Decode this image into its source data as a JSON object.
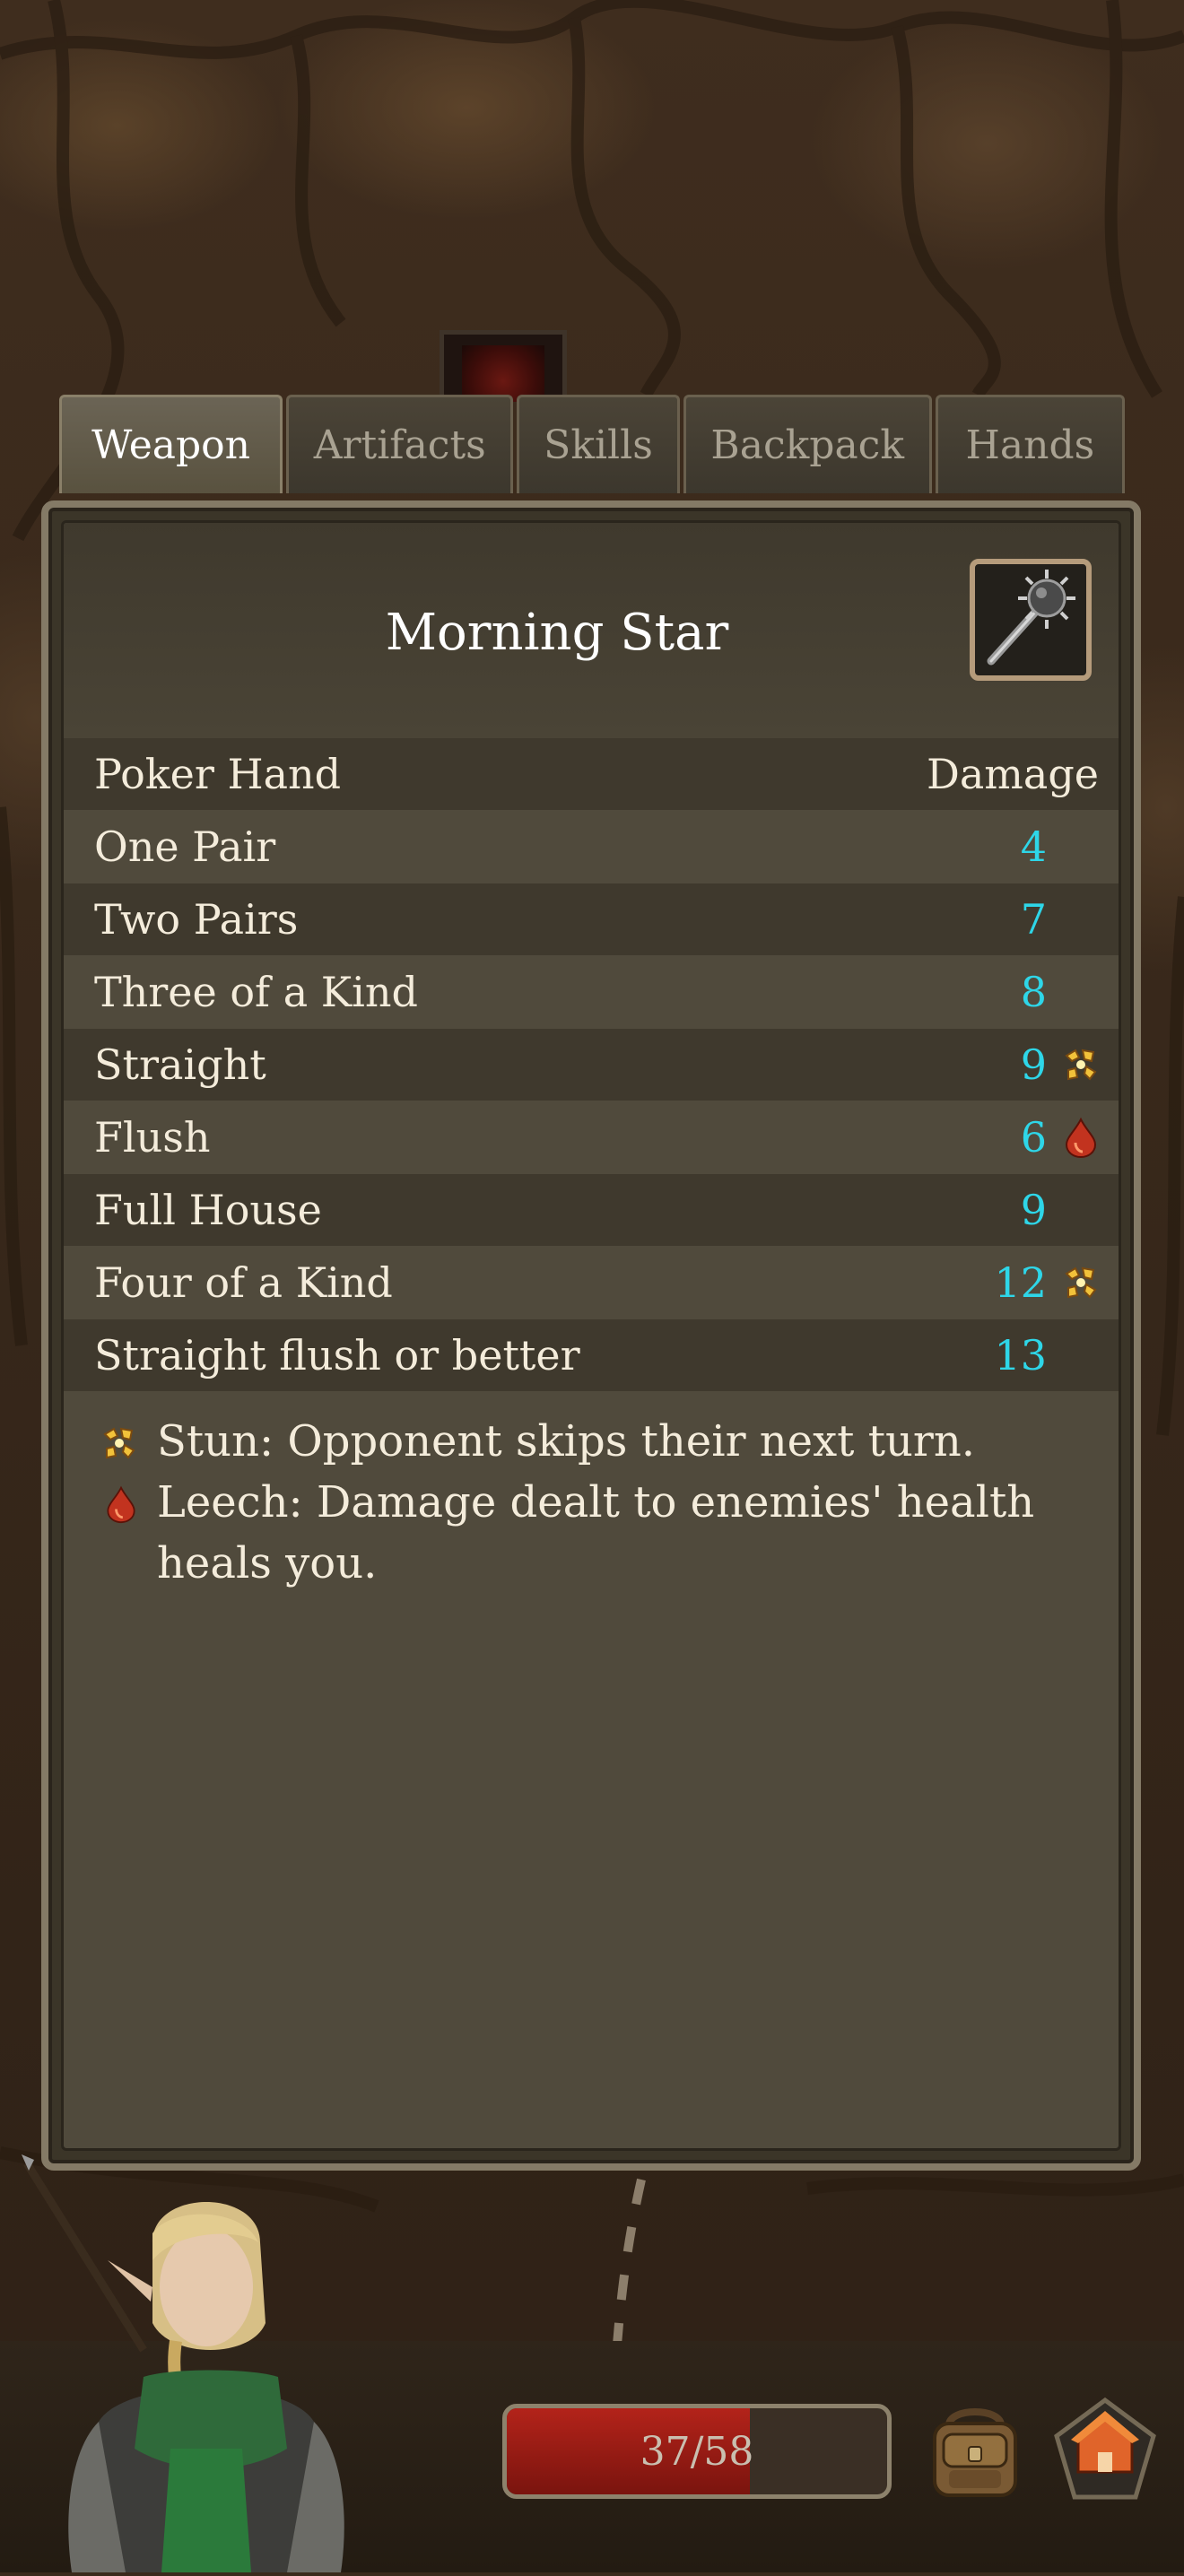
{
  "tabs": [
    {
      "label": "Weapon",
      "active": true
    },
    {
      "label": "Artifacts",
      "active": false
    },
    {
      "label": "Skills",
      "active": false
    },
    {
      "label": "Backpack",
      "active": false
    },
    {
      "label": "Hands",
      "active": false
    }
  ],
  "weapon": {
    "name": "Morning Star",
    "icon": "morning-star-icon"
  },
  "table": {
    "header": {
      "hand": "Poker Hand",
      "damage": "Damage"
    },
    "rows": [
      {
        "hand": "One Pair",
        "damage": "4",
        "effect": null
      },
      {
        "hand": "Two Pairs",
        "damage": "7",
        "effect": null
      },
      {
        "hand": "Three of a Kind",
        "damage": "8",
        "effect": null
      },
      {
        "hand": "Straight",
        "damage": "9",
        "effect": "stun-icon"
      },
      {
        "hand": "Flush",
        "damage": "6",
        "effect": "leech-icon"
      },
      {
        "hand": "Full House",
        "damage": "9",
        "effect": null
      },
      {
        "hand": "Four of a Kind",
        "damage": "12",
        "effect": "stun-icon"
      },
      {
        "hand": "Straight flush or better",
        "damage": "13",
        "effect": null
      }
    ]
  },
  "legend": {
    "stun": "Stun: Opponent skips their next turn.",
    "leech": "Leech: Damage dealt to enemies' health heals you."
  },
  "player": {
    "hp_text": "37/58",
    "hp_fraction": 0.638
  },
  "colors": {
    "damage_value": "#2ed6e8",
    "hp_fill": "#b3231a"
  }
}
